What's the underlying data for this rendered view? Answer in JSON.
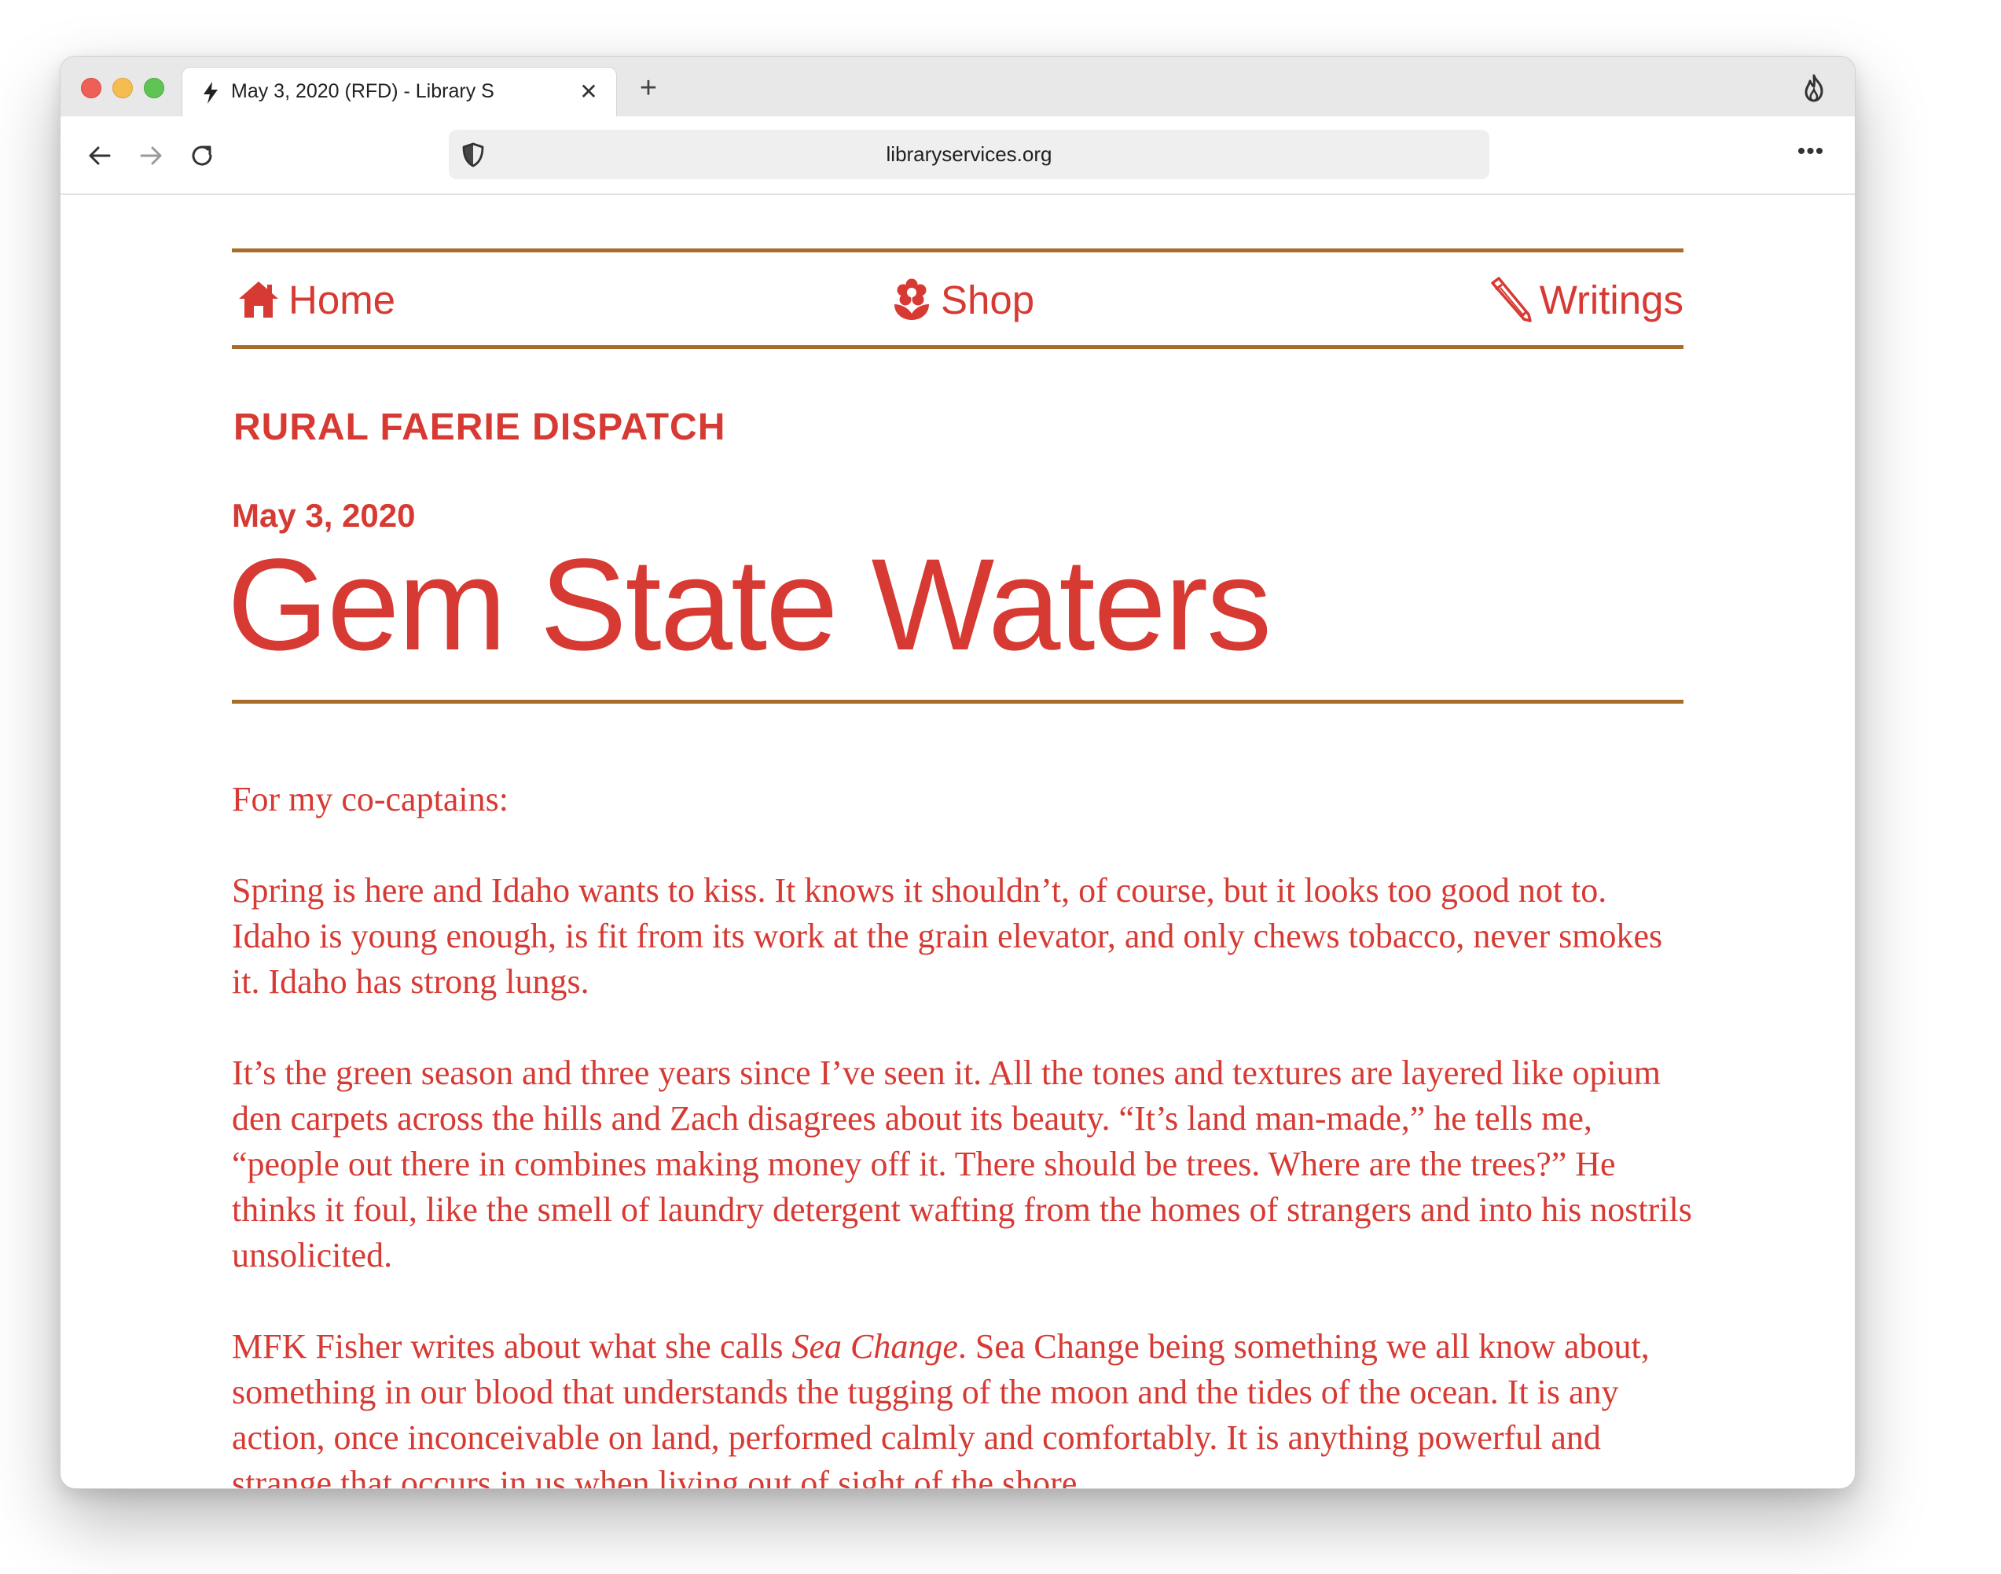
{
  "browser": {
    "tab_title": "May 3, 2020 (RFD) - Library S",
    "tab_close": "✕",
    "new_tab": "+",
    "url": "libraryservices.org",
    "menu": "•••"
  },
  "site_nav": {
    "home": "Home",
    "shop": "Shop",
    "writings": "Writings"
  },
  "article": {
    "kicker": "RURAL FAERIE DISPATCH",
    "date": "May 3, 2020",
    "title": "Gem State Waters",
    "salutation": "For my co-captains:",
    "paragraph_1": "Spring is here and Idaho wants to kiss. It knows it shouldn’t, of course, but it looks too good not to. Idaho is young enough, is fit from its work at the grain elevator, and only chews tobacco, never smokes it. Idaho has strong lungs.",
    "paragraph_2": "It’s the green season and three years since I’ve seen it. All the tones and textures are layered like opium den carpets across the hills and Zach disagrees about its beauty. “It’s land man-made,” he tells me, “people out there in combines making money off it. There should be trees. Where are the trees?” He thinks it foul, like the smell of laundry detergent wafting from the homes of strangers and into his nostrils unsolicited.",
    "paragraph_3_pre": "MFK Fisher writes about what she calls ",
    "paragraph_3_em": "Sea Change",
    "paragraph_3_post": ". Sea Change being something we all know about, something in our blood that understands the tugging of the moon and the tides of the ocean. It is any action, once inconceivable on land, performed calmly and comfortably. It is anything powerful and strange that occurs in us when living out of sight of the shore."
  },
  "colors": {
    "accent_red": "#d63a33",
    "rule_brown": "#a86d2a"
  },
  "icons": {
    "tab": "lightning-icon",
    "home": "house-icon",
    "shop": "flower-icon",
    "writings": "pencil-icon",
    "toolbar_right": "flame-icon",
    "url": "shield-icon"
  }
}
